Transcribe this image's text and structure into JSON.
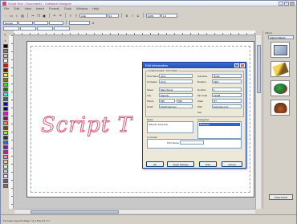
{
  "window": {
    "title": "Script Text - Document1 - Software Designer",
    "controls": {
      "minimize": "_",
      "maximize": "□",
      "close": "×"
    }
  },
  "menu": [
    "File",
    "Edit",
    "View",
    "Insert",
    "Format",
    "Tools",
    "Window",
    "Help"
  ],
  "toolbar": {
    "font_name": "Arial",
    "font_size": "12",
    "zoom": "100%",
    "style": "Normal",
    "page_label": "1/1"
  },
  "canvas": {
    "script_text": "Script T"
  },
  "right_panel": {
    "header": "Clipart",
    "category": "Clipart Objects",
    "close_button": "Close Panel"
  },
  "status": {
    "text": "For Help, press F1  Page 1 of 1  Pos 3.2, 4.7"
  },
  "colors": {
    "accent": "#1f4fb8",
    "script_outline": "#d55b7e",
    "palette": [
      "#000000",
      "#808080",
      "#c0c0c0",
      "#ffffff",
      "#ff0000",
      "#800000",
      "#ffff00",
      "#808000",
      "#00ff00",
      "#008000",
      "#00ffff",
      "#008080",
      "#0000ff",
      "#000080",
      "#ff00ff",
      "#800080",
      "#ff8040",
      "#804000",
      "#80ff00",
      "#004040",
      "#0080ff",
      "#8000ff",
      "#ff0080",
      "#ff80c0",
      "#ffc0a0",
      "#c0ffc0",
      "#c0c0ff",
      "#e0e0ff",
      "#6060a0",
      "#a06060"
    ]
  },
  "dialog": {
    "title": "Edit Information",
    "help": "?",
    "close": "×",
    "group_main": "Contact Details / Information",
    "labels": {
      "first_name": "First Name",
      "company": "Company",
      "street": "Street",
      "city": "City",
      "phone": "Phone",
      "email": "Email",
      "last_name": "Surname",
      "position": "Position",
      "number": "Number",
      "zip": "Zip Code",
      "state": "State",
      "fax": "Fax",
      "web": "Web",
      "notes": "Notes",
      "categories": "Categories",
      "comment": "Comment",
      "print_name": "Print Name"
    },
    "values": {
      "first_name": "John",
      "company": "Corp",
      "street": "Main Street",
      "city": "Sample",
      "phone": "555",
      "email": "info@mail.com",
      "last_name": "Smith",
      "position": "CEO",
      "number": "1",
      "zip": "12345",
      "state": "NY",
      "fax": "556",
      "web": "www.site.com",
      "notes": "Sample notes text",
      "category_selected": "Business",
      "comment": "",
      "print_name": ""
    },
    "buttons": {
      "ok": "OK",
      "apply": "Apply Settings",
      "print": "Print",
      "cancel": "Cancel"
    }
  }
}
